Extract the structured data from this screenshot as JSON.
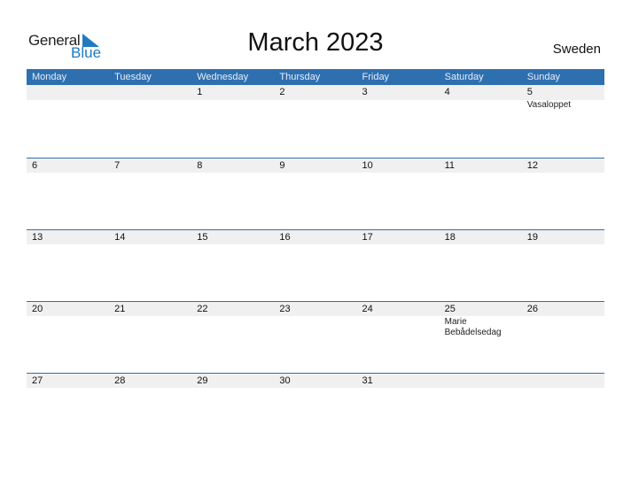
{
  "logo": {
    "word1": "General",
    "word2": "Blue",
    "color_dark": "#222222",
    "color_blue": "#1f7bc1"
  },
  "title": "March 2023",
  "country": "Sweden",
  "header_color": "#2e6fb0",
  "weekdays": [
    "Monday",
    "Tuesday",
    "Wednesday",
    "Thursday",
    "Friday",
    "Saturday",
    "Sunday"
  ],
  "weeks": [
    [
      {
        "day": ""
      },
      {
        "day": ""
      },
      {
        "day": "1"
      },
      {
        "day": "2"
      },
      {
        "day": "3"
      },
      {
        "day": "4"
      },
      {
        "day": "5",
        "event": "Vasaloppet"
      }
    ],
    [
      {
        "day": "6"
      },
      {
        "day": "7"
      },
      {
        "day": "8"
      },
      {
        "day": "9"
      },
      {
        "day": "10"
      },
      {
        "day": "11"
      },
      {
        "day": "12"
      }
    ],
    [
      {
        "day": "13"
      },
      {
        "day": "14"
      },
      {
        "day": "15"
      },
      {
        "day": "16"
      },
      {
        "day": "17"
      },
      {
        "day": "18"
      },
      {
        "day": "19"
      }
    ],
    [
      {
        "day": "20"
      },
      {
        "day": "21"
      },
      {
        "day": "22"
      },
      {
        "day": "23"
      },
      {
        "day": "24"
      },
      {
        "day": "25",
        "event": "Marie Bebådelsedag"
      },
      {
        "day": "26"
      }
    ],
    [
      {
        "day": "27"
      },
      {
        "day": "28"
      },
      {
        "day": "29"
      },
      {
        "day": "30"
      },
      {
        "day": "31"
      },
      {
        "day": ""
      },
      {
        "day": ""
      }
    ]
  ]
}
